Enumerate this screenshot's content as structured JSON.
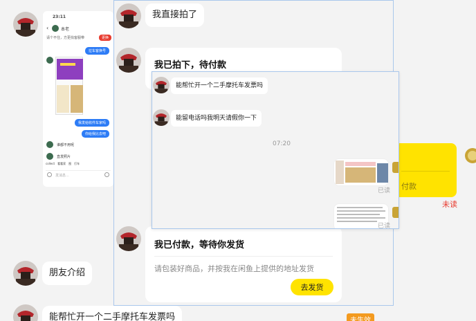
{
  "messages": {
    "took_photo": "我直接拍了",
    "friend_intro": "朋友介绍",
    "help_moto_invoice": "能帮忙开一个二手摩托车发票吗"
  },
  "card_paid_waiting": {
    "title": "我已拍下，待付款"
  },
  "card_paid": {
    "title": "我已付款，等待你发货",
    "subtitle": "请包装好商品，并按我在闲鱼上提供的地址发货",
    "button": "去发货"
  },
  "popup": {
    "msg1": "能帮忙开一个二手摩托车发票吗",
    "msg2": "能留电话吗我明天请假你一下",
    "time": "07:20",
    "read1": "已读",
    "read2": "已读"
  },
  "right": {
    "partial_label": "付款",
    "unread": "未读"
  },
  "badge": {
    "status": "未生效"
  },
  "phone": {
    "time": "23:11",
    "contact": "本老",
    "banner": "请个不住，方更找客服带",
    "banner_tag": "更换",
    "msg_blue1": "拉车客换号",
    "msg_blue2": "我发给收件车家吗",
    "msg_blue3": "你给我比去吧",
    "msg_gray1": "谁都不用呢",
    "msg_gray2": "直发照片",
    "toolbar": [
      "collect",
      "看看家",
      "图",
      "打车"
    ],
    "input_placeholder": "发消息..."
  },
  "colors": {
    "accent_yellow": "#ffe300",
    "panel_border": "#a9c7ec",
    "unread_red": "#e83b2f",
    "badge_orange": "#f39a1f",
    "bubble_blue": "#2d7cf6"
  }
}
